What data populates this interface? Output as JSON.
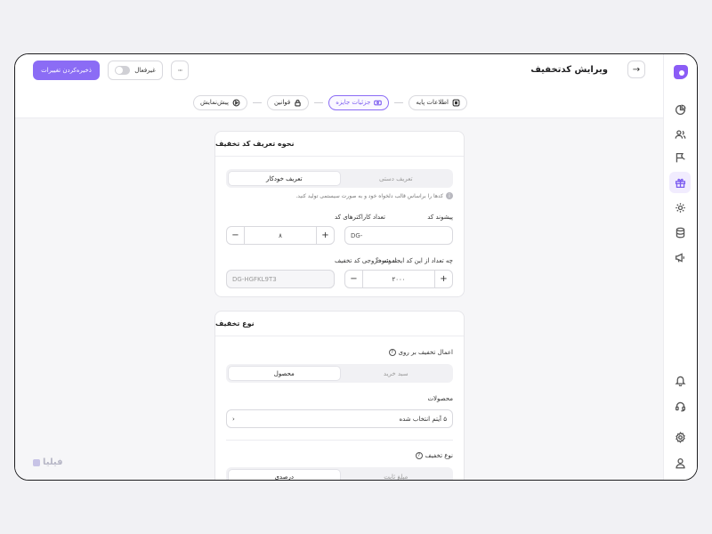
{
  "header": {
    "title": "ویرایش کدتخفیف",
    "save_label": "ذخیره‌کردن تغییرات",
    "status_label": "غیرفعال",
    "more_label": "···"
  },
  "steps": [
    {
      "label": "اطلاعات پایه",
      "icon": "list-icon",
      "active": false
    },
    {
      "label": "جزئیات جایزه",
      "icon": "ticket-icon",
      "active": true
    },
    {
      "label": "قوانین",
      "icon": "lock-icon",
      "active": false
    },
    {
      "label": "پیش‌نمایش",
      "icon": "play-icon",
      "active": false
    }
  ],
  "definition_card": {
    "title": "نحوه تعریف کد تخفیف",
    "seg_manual": "تعریف دستی",
    "seg_auto": "تعریف خودکار",
    "hint": "کدها را براساس قالب دلخواه خود و به صورت سیستمی تولید کنید.",
    "prefix_label": "پیشوند کد",
    "prefix_value": "DG-",
    "chars_label": "تعداد کاراکترهای کد",
    "chars_value": "۸",
    "count_label": "چه تعداد از این کد ایجاد شود؟",
    "count_value": "۲۰۰۰",
    "sample_label": "نمونه خروجی کد تخفیف",
    "sample_value": "DG-HGFKL9T3"
  },
  "type_card": {
    "title": "نوع تخفیف",
    "apply_label": "اعمال تخفیف بر روی",
    "seg_cart": "سبد خرید",
    "seg_product": "محصول",
    "products_label": "محصولات",
    "products_value": "۵ آیتم انتخاب شده",
    "discount_type_label": "نوع تخفیف",
    "seg_fixed": "مبلغ ثابت",
    "seg_percent": "درصدی"
  },
  "brand": {
    "name": "فیلیا"
  },
  "colors": {
    "accent": "#8b6cf5"
  }
}
